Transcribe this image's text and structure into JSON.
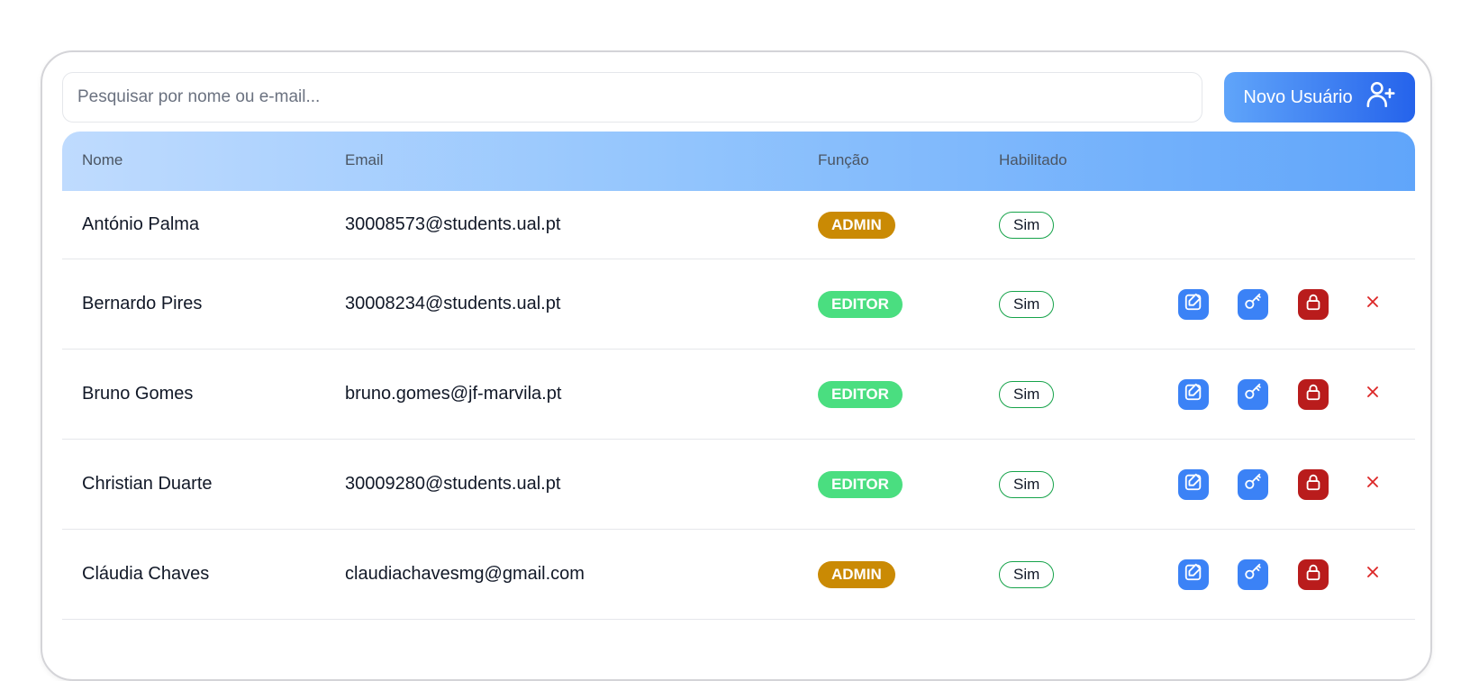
{
  "search": {
    "placeholder": "Pesquisar por nome ou e-mail..."
  },
  "new_user_button": {
    "label": "Novo Usuário",
    "icon": "user-plus-icon"
  },
  "colors": {
    "primary": "#3b82f6",
    "admin_badge": "#ca8a04",
    "editor_badge": "#4ade80",
    "enabled_border": "#16a34a",
    "lock_button": "#b91c1c",
    "delete_icon": "#dc2626"
  },
  "table": {
    "headers": {
      "nome": "Nome",
      "email": "Email",
      "funcao": "Função",
      "habilitado": "Habilitado"
    },
    "rows": [
      {
        "nome": "António Palma",
        "email": "30008573@students.ual.pt",
        "funcao": "ADMIN",
        "habilitado": "Sim"
      },
      {
        "nome": "Bernardo Pires",
        "email": "30008234@students.ual.pt",
        "funcao": "EDITOR",
        "habilitado": "Sim"
      },
      {
        "nome": "Bruno Gomes",
        "email": "bruno.gomes@jf-marvila.pt",
        "funcao": "EDITOR",
        "habilitado": "Sim"
      },
      {
        "nome": "Christian Duarte",
        "email": "30009280@students.ual.pt",
        "funcao": "EDITOR",
        "habilitado": "Sim"
      },
      {
        "nome": "Cláudia Chaves",
        "email": "claudiachavesmg@gmail.com",
        "funcao": "ADMIN",
        "habilitado": "Sim"
      }
    ],
    "actions": [
      "edit-icon",
      "key-icon",
      "lock-icon",
      "close-icon"
    ]
  }
}
